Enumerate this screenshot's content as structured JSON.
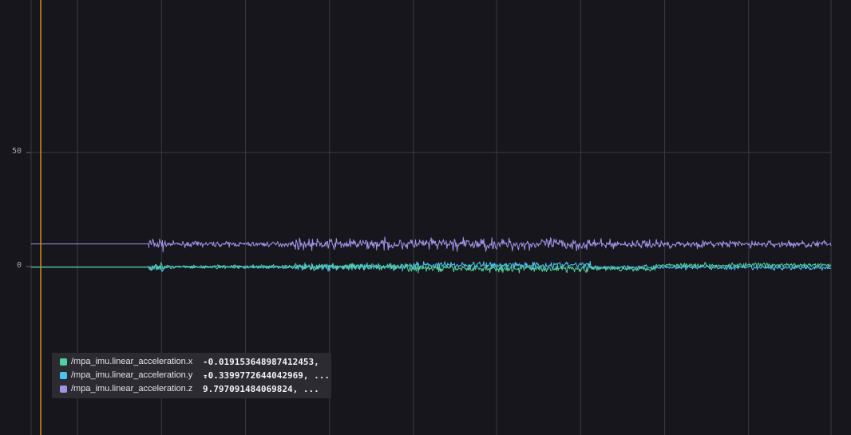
{
  "chart_data": {
    "type": "line",
    "ylim": [
      -74,
      117
    ],
    "xlim": [
      0,
      100
    ],
    "yticks": [
      {
        "value": 50,
        "label": "50"
      },
      {
        "value": 0,
        "label": "0"
      }
    ],
    "cursor": {
      "x": 1.2,
      "color": "#d88e16"
    },
    "signal_start_x": 14.7,
    "x_gridlines": [
      0,
      5.8,
      16.3,
      26.8,
      37.3,
      47.8,
      58.2,
      68.7,
      79.2,
      89.7,
      100
    ],
    "grid": true,
    "series": [
      {
        "name": "/mpa_imu.linear_acceleration.x",
        "value_text": "-0.019153648987412453, ...",
        "color": "#4fd1a1",
        "baseline": -0.02,
        "initial": -0.3
      },
      {
        "name": "/mpa_imu.linear_acceleration.y",
        "value_text": "-0.3399772644042969, ...",
        "color": "#4cc4f2",
        "baseline": -0.34,
        "initial": -0.3
      },
      {
        "name": "/mpa_imu.linear_acceleration.z",
        "value_text": "9.797091484069824, ...",
        "color": "#a293e8",
        "baseline": 9.8,
        "initial": 9.9
      }
    ]
  },
  "legend": {
    "position": "bottom-left"
  }
}
